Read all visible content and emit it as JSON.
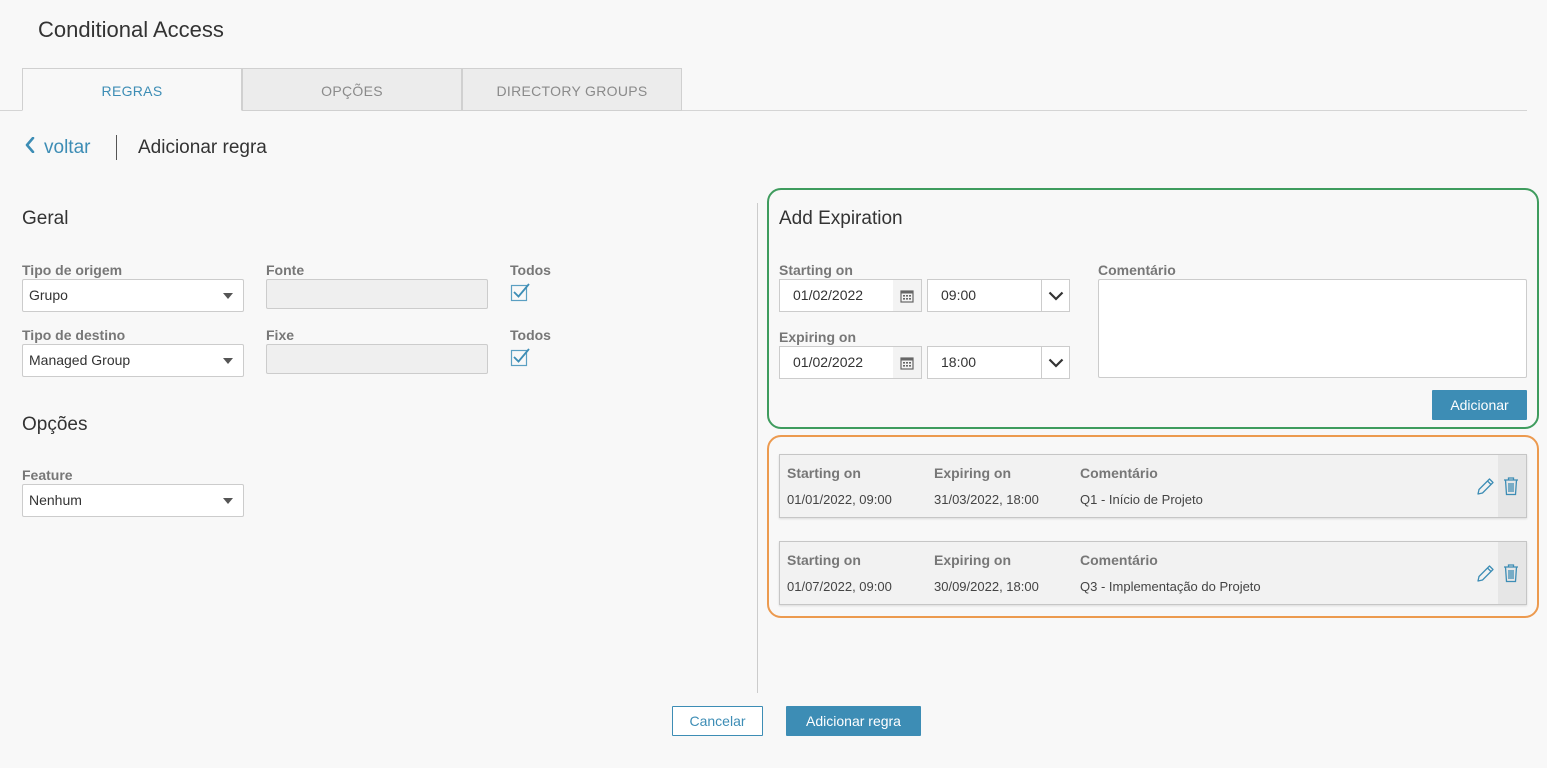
{
  "app": {
    "title": "Conditional Access"
  },
  "tabs": [
    {
      "label": "REGRAS",
      "active": true
    },
    {
      "label": "OPÇÕES",
      "active": false
    },
    {
      "label": "DIRECTORY GROUPS",
      "active": false
    }
  ],
  "breadcrumb": {
    "back_label": "voltar",
    "title": "Adicionar regra"
  },
  "geral": {
    "title": "Geral",
    "tipo_origem": {
      "label": "Tipo de origem",
      "value": "Grupo"
    },
    "fonte": {
      "label": "Fonte",
      "value": ""
    },
    "todos_1": {
      "label": "Todos",
      "checked": true
    },
    "tipo_destino": {
      "label": "Tipo de destino",
      "value": "Managed Group"
    },
    "fixe": {
      "label": "Fixe",
      "value": ""
    },
    "todos_2": {
      "label": "Todos",
      "checked": true
    }
  },
  "opcoes": {
    "title": "Opções",
    "feature": {
      "label": "Feature",
      "value": "Nenhum"
    }
  },
  "expiration": {
    "title": "Add Expiration",
    "starting_on": {
      "label": "Starting on",
      "date": "01/02/2022",
      "time": "09:00"
    },
    "expiring_on": {
      "label": "Expiring on",
      "date": "01/02/2022",
      "time": "18:00"
    },
    "comment": {
      "label": "Comentário",
      "value": ""
    },
    "add_button": "Adicionar"
  },
  "entries": {
    "headers": {
      "starting": "Starting on",
      "expiring": "Expiring on",
      "comment": "Comentário"
    },
    "rows": [
      {
        "starting": "01/01/2022, 09:00",
        "expiring": "31/03/2022, 18:00",
        "comment": "Q1 - Início de Projeto"
      },
      {
        "starting": "01/07/2022, 09:00",
        "expiring": "30/09/2022, 18:00",
        "comment": "Q3 - Implementação do Projeto"
      }
    ]
  },
  "footer": {
    "cancel": "Cancelar",
    "submit": "Adicionar regra"
  },
  "colors": {
    "accent": "#3d8db5",
    "highlight_green": "#3f9c5e",
    "highlight_orange": "#ec9a4f"
  }
}
